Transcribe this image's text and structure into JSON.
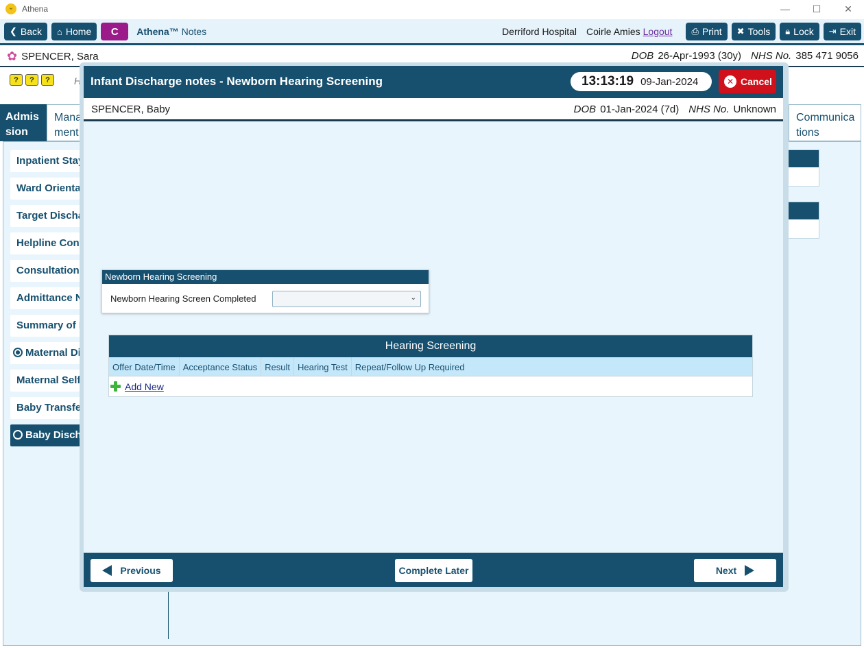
{
  "window": {
    "title": "Athena",
    "controls": {
      "minimize": "—",
      "maximize": "☐",
      "close": "✕"
    }
  },
  "toolbar": {
    "back_label": "Back",
    "home_label": "Home",
    "c_label": "C",
    "brand_bold": "Athena™",
    "brand_rest": " Notes",
    "hospital": "Derriford Hospital",
    "user": "Coirle Amies",
    "logout_label": "Logout",
    "print_label": "Print",
    "tools_label": "Tools",
    "lock_label": "Lock",
    "exit_label": "Exit"
  },
  "patient": {
    "name": "SPENCER, Sara",
    "dob_label": "DOB",
    "dob": "26-Apr-1993 (30y)",
    "nhs_label": "NHS No.",
    "nhs": "385 471 9056"
  },
  "help_icons": [
    "?",
    "?",
    "?"
  ],
  "background": {
    "h_letter": "H",
    "tabs": {
      "admission": "Admis sion",
      "management": "Mana ment",
      "communications": "Communica tions"
    },
    "sidebar_items": [
      "Inpatient Stay",
      "Ward Orientation",
      "Target Discharge",
      "Helpline Contact",
      "Consultation Notes",
      "Admittance Notes",
      "Summary of Plan",
      "Maternal Discharge",
      "Maternal Self Care",
      "Baby Transfer",
      "Baby Discharge"
    ]
  },
  "modal": {
    "title": "Infant Discharge notes - Newborn Hearing Screening",
    "time": "13:13:19",
    "date": "09-Jan-2024",
    "cancel_label": "Cancel",
    "baby": {
      "name": "SPENCER, Baby",
      "dob_label": "DOB",
      "dob": "01-Jan-2024 (7d)",
      "nhs_label": "NHS No.",
      "nhs": "Unknown"
    },
    "nhs_box": {
      "header": "Newborn Hearing Screening",
      "field_label": "Newborn Hearing Screen Completed",
      "field_value": ""
    },
    "hearing_table": {
      "title": "Hearing Screening",
      "columns": [
        "Offer Date/Time",
        "Acceptance Status",
        "Result",
        "Hearing Test",
        "Repeat/Follow Up Required"
      ],
      "add_label": "Add New"
    },
    "footer": {
      "previous_label": "Previous",
      "complete_later_label": "Complete Later",
      "next_label": "Next"
    }
  }
}
